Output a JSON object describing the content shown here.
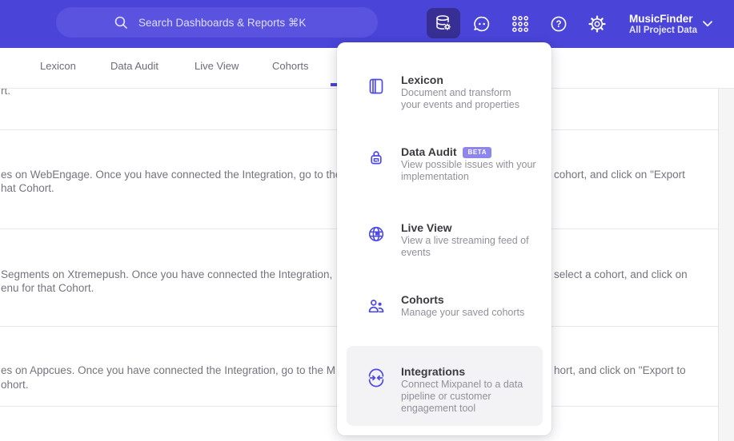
{
  "header": {
    "search_placeholder": "Search Dashboards & Reports ⌘K",
    "project_name": "MusicFinder",
    "project_scope": "All Project Data",
    "icons": [
      "search-icon",
      "data-management-icon",
      "feedback-bubble-icon",
      "apps-grid-icon",
      "help-icon",
      "settings-gear-icon",
      "chevron-down-icon"
    ]
  },
  "tabs": [
    {
      "label": "Lexicon"
    },
    {
      "label": "Data Audit"
    },
    {
      "label": "Live View"
    },
    {
      "label": "Cohorts"
    }
  ],
  "menu": {
    "items": [
      {
        "title": "Lexicon",
        "icon": "book-icon",
        "desc_lines": [
          "Document and transform",
          "your events and properties"
        ]
      },
      {
        "title": "Data Audit",
        "badge": "BETA",
        "icon": "lock-audit-icon",
        "desc_lines": [
          "View possible issues with your",
          "implementation"
        ]
      },
      {
        "title": "Live View",
        "icon": "globe-icon",
        "desc_lines": [
          "View a live streaming feed of",
          "events"
        ]
      },
      {
        "title": "Cohorts",
        "icon": "people-icon",
        "desc_lines": [
          "Manage your saved cohorts"
        ]
      },
      {
        "title": "Integrations",
        "icon": "sync-arrows-icon",
        "highlighted": true,
        "desc_lines": [
          "Connect Mixpanel to a data",
          "pipeline or customer",
          "engagement tool"
        ]
      }
    ]
  },
  "background": {
    "f0": "rt.",
    "f1_left": "es on WebEngage. Once you have connected the Integration, go to the",
    "f1_right": "cohort, and click on \"Export",
    "f1_cont": "hat Cohort.",
    "f2_left": "Segments on Xtremepush. Once you have connected the Integration,",
    "f2_right": "select a cohort, and click on",
    "f2_cont": "enu for that Cohort.",
    "f3_left": "es on Appcues. Once you have connected the Integration, go to the M",
    "f3_right": "hort, and click on \"Export to",
    "f3_cont": "ohort."
  },
  "colors": {
    "header_purple": "#4a44d9",
    "active_button_purple": "#372f93",
    "accent_indigo": "#4c49e8",
    "beta_badge_purple": "#8f86ec",
    "hover_item_gray": "#f3f3f5"
  }
}
